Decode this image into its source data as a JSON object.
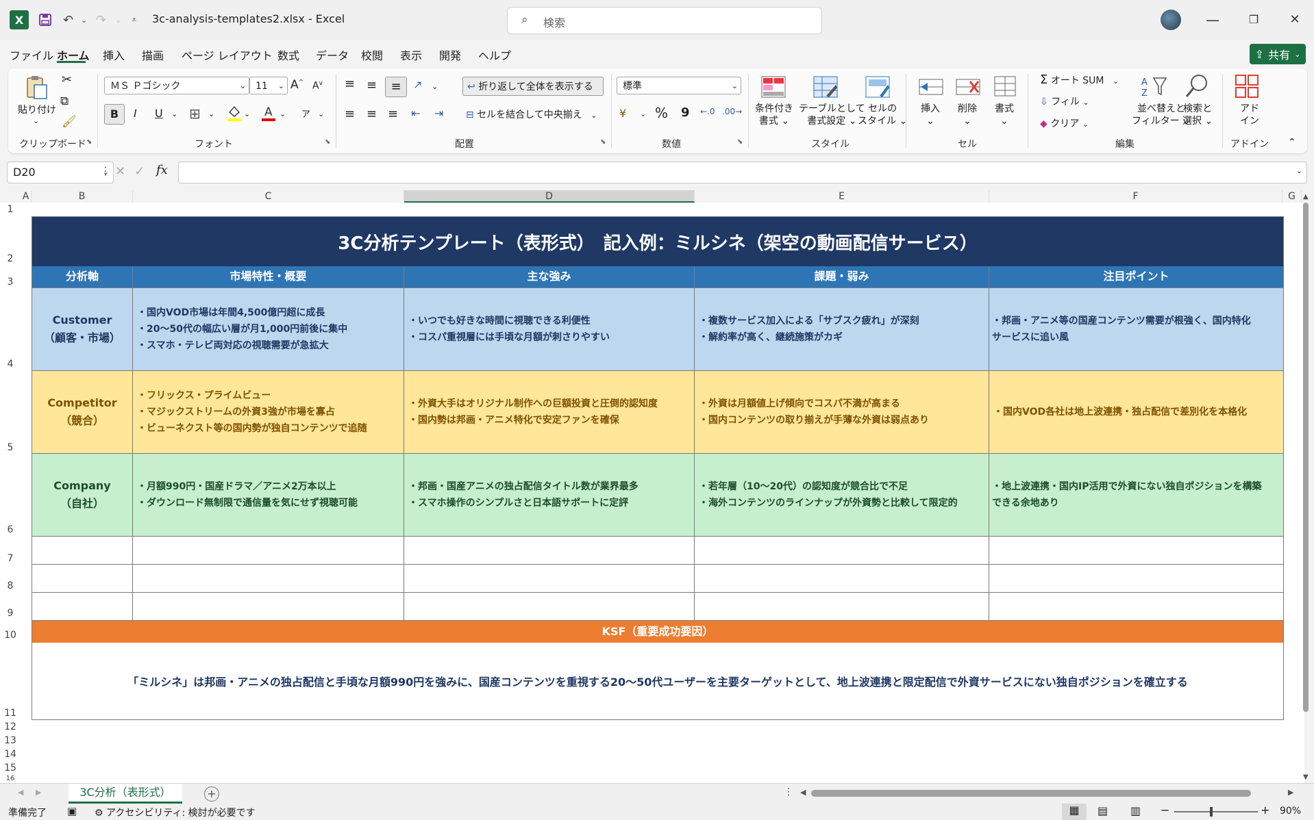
{
  "titlebar": {
    "app_icon": "X",
    "save_icon": "save-icon",
    "undo_icon": "undo-icon",
    "redo_icon": "redo-icon",
    "customize_icon": "customize-icon",
    "doc_title": "3c-analysis-templates2.xlsx  -  Excel",
    "search_placeholder": "検索",
    "minimize": "—",
    "restore": "❐",
    "close": "✕"
  },
  "menu": {
    "tabs": [
      "ファイル",
      "ホーム",
      "挿入",
      "描画",
      "ページ レイアウト",
      "数式",
      "データ",
      "校閲",
      "表示",
      "開発",
      "ヘルプ"
    ],
    "active": "ホーム",
    "share_label": "共有"
  },
  "ribbon": {
    "clipboard": {
      "paste": "貼り付け",
      "label": "クリップボード"
    },
    "font": {
      "name": "ＭＳ Ｐゴシック",
      "size": "11",
      "label": "フォント",
      "bold": "B",
      "italic": "I",
      "underline": "U",
      "grow": "A",
      "shrink": "A",
      "phonetic": "ア"
    },
    "alignment": {
      "wrap": "折り返して全体を表示する",
      "merge": "セルを結合して中央揃え",
      "label": "配置"
    },
    "number": {
      "format": "標準",
      "percent": "%",
      "comma": "9",
      "label": "数値"
    },
    "styles": {
      "conditional": [
        "条件付き",
        "書式"
      ],
      "table": [
        "テーブルとして",
        "書式設定"
      ],
      "cell": [
        "セルの",
        "スタイル"
      ],
      "label": "スタイル"
    },
    "cells": {
      "insert": "挿入",
      "delete": "削除",
      "format": "書式",
      "label": "セル"
    },
    "editing": {
      "autosum": "オート SUM",
      "fill": "フィル",
      "clear": "クリア",
      "sort": [
        "並べ替えと",
        "フィルター"
      ],
      "find": [
        "検索と",
        "選択"
      ],
      "label": "編集"
    },
    "addins": {
      "addin": [
        "アド",
        "イン"
      ],
      "label": "アドイン"
    }
  },
  "formula_bar": {
    "name_box": "D20",
    "fx": "fx",
    "value": ""
  },
  "columns": [
    "A",
    "B",
    "C",
    "D",
    "E",
    "F",
    "G"
  ],
  "rows": [
    "1",
    "2",
    "3",
    "4",
    "5",
    "6",
    "7",
    "8",
    "9",
    "10",
    "11",
    "12",
    "13",
    "14",
    "15",
    "16"
  ],
  "sheet": {
    "title": "3C分析テンプレート（表形式）　記入例：ミルシネ（架空の動画配信サービス）",
    "headers": [
      "分析軸",
      "市場特性・概要",
      "主な強み",
      "課題・弱み",
      "注目ポイント"
    ],
    "rows": [
      {
        "axis": [
          "Customer",
          "（顧客・市場）"
        ],
        "market": [
          "・国内VOD市場は年間4,500億円超に成長",
          "・20～50代の幅広い層が月1,000円前後に集中",
          "・スマホ・テレビ両対応の視聴需要が急拡大"
        ],
        "strengths": [
          "・いつでも好きな時間に視聴できる利便性",
          "・コスパ重視層には手頃な月額が刺さりやすい"
        ],
        "weaknesses": [
          "・複数サービス加入による「サブスク疲れ」が深刻",
          "・解約率が高く、継続施策がカギ"
        ],
        "points": [
          "・邦画・アニメ等の国産コンテンツ需要が根強く、国内特化",
          "サービスに追い風"
        ]
      },
      {
        "axis": [
          "Competitor",
          "（競合）"
        ],
        "market": [
          "・フリックス・プライムビュー",
          "・マジックストリームの外資3強が市場を寡占",
          "・ビューネクスト等の国内勢が独自コンテンツで追随"
        ],
        "strengths": [
          "・外資大手はオリジナル制作への巨額投資と圧倒的認知度",
          "・国内勢は邦画・アニメ特化で安定ファンを確保"
        ],
        "weaknesses": [
          "・外資は月額値上げ傾向でコスパ不満が高まる",
          "・国内コンテンツの取り揃えが手薄な外資は弱点あり"
        ],
        "points": [
          "・国内VOD各社は地上波連携・独占配信で差別化を本格化"
        ]
      },
      {
        "axis": [
          "Company",
          "（自社）"
        ],
        "market": [
          "・月額990円・国産ドラマ／アニメ2万本以上",
          "・ダウンロード無制限で通信量を気にせず視聴可能"
        ],
        "strengths": [
          "・邦画・国産アニメの独占配信タイトル数が業界最多",
          "・スマホ操作のシンプルさと日本語サポートに定評"
        ],
        "weaknesses": [
          "・若年層（10～20代）の認知度が競合比で不足",
          "・海外コンテンツのラインナップが外資勢と比較して限定的"
        ],
        "points": [
          "・地上波連携・国内IP活用で外資にない独自ポジションを構築",
          "できる余地あり"
        ]
      }
    ],
    "ksf_label": "KSF（重要成功要因）",
    "ksf_text": "「ミルシネ」は邦画・アニメの独占配信と手頃な月額990円を強みに、国産コンテンツを重視する20～50代ユーザーを主要ターゲットとして、地上波連携と限定配信で外資サービスにない独自ポジションを確立する",
    "colors": {
      "title_bg": "#1f3864",
      "header_bg": "#2e75b6",
      "customer_bg": "#bdd7ee",
      "competitor_bg": "#ffe699",
      "company_bg": "#c6efce",
      "ksf_bg": "#ed7d31"
    }
  },
  "sheet_tabs": {
    "active": "3C分析（表形式）",
    "add": "+"
  },
  "status": {
    "ready": "準備完了",
    "accessibility": "アクセシビリティ: 検討が必要です",
    "zoom": "90%"
  }
}
